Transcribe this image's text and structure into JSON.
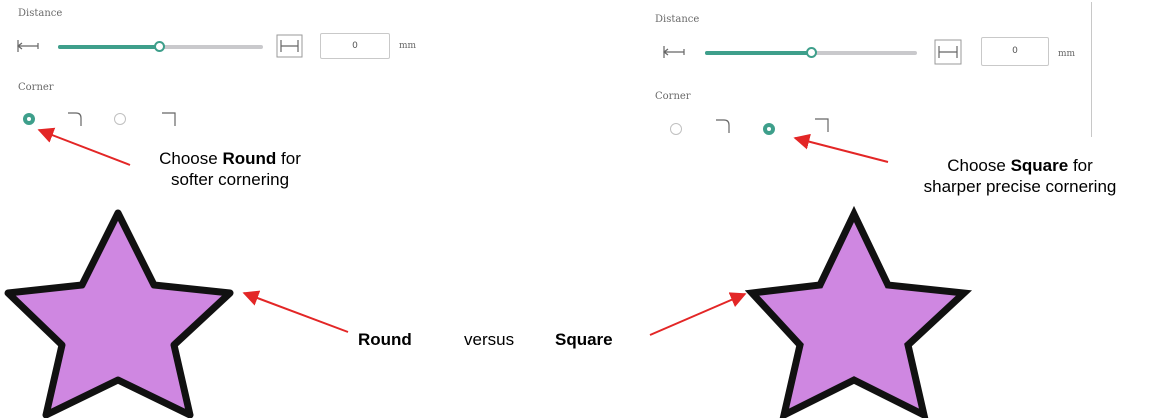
{
  "left_panel": {
    "distance_label": "Distance",
    "distance_value": "0",
    "distance_unit": "mm",
    "slider_fraction": 0.5,
    "corner_label": "Corner",
    "selected_corner": "round"
  },
  "right_panel": {
    "distance_label": "Distance",
    "distance_value": "0",
    "distance_unit": "mm",
    "slider_fraction": 0.5,
    "corner_label": "Corner",
    "selected_corner": "square"
  },
  "annotations": {
    "round_callout_prefix": "Choose",
    "round_callout_bold": "Round",
    "round_callout_suffix": "for",
    "round_callout_line2": "softer cornering",
    "square_callout_prefix": "Choose",
    "square_callout_bold": "Square",
    "square_callout_suffix": "for",
    "square_callout_line2": "sharper precise cornering",
    "round_word": "Round",
    "versus_word": "versus",
    "square_word": "Square"
  },
  "colors": {
    "accent": "#3e9f8b",
    "star_fill": "#cf87e1",
    "arrow": "#e32626"
  },
  "icons": [
    "distance-start-icon",
    "distance-end-icon",
    "rounded-corner-icon",
    "square-corner-icon",
    "star-shape"
  ]
}
